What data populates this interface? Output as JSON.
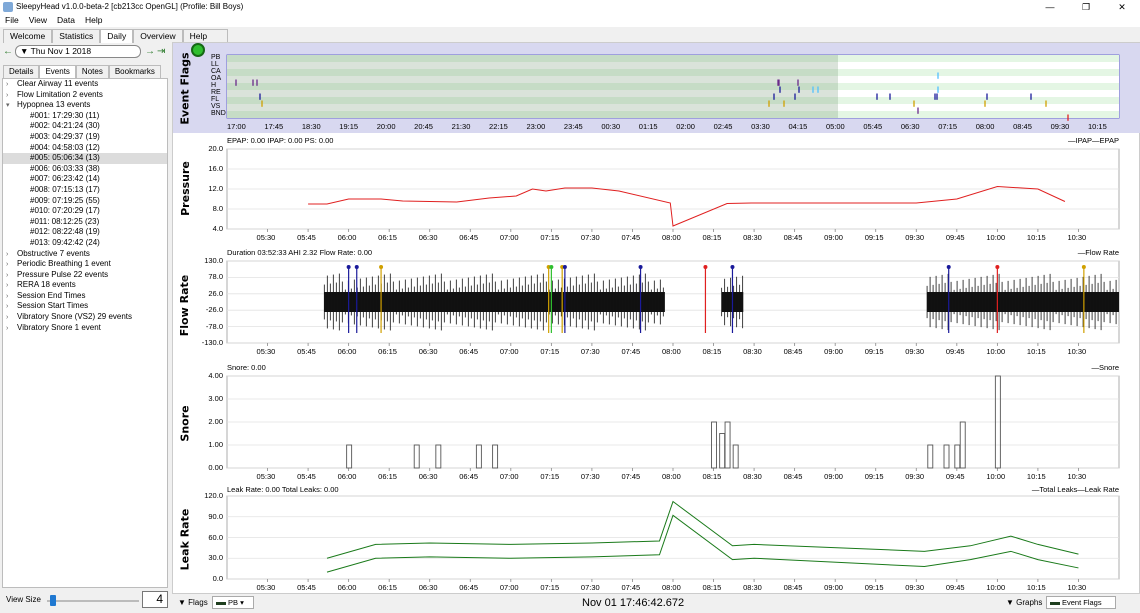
{
  "window": {
    "title": "SleepyHead v1.0.0-beta-2 [cb213cc OpenGL] (Profile: Bill Boys)",
    "min": "—",
    "max": "❐",
    "close": "✕"
  },
  "menu": [
    "File",
    "View",
    "Data",
    "Help"
  ],
  "main_tabs": [
    "Welcome",
    "Statistics",
    "Daily",
    "Overview",
    "Help Browser"
  ],
  "active_main_tab": "Daily",
  "date": {
    "value": "Thu Nov 1 2018",
    "prev": "←",
    "next": "→",
    "jump": "⇥"
  },
  "sub_tabs": [
    "Details",
    "Events",
    "Notes",
    "Bookmarks"
  ],
  "active_sub_tab": "Events",
  "events_tree": [
    {
      "label": "Clear Airway 11 events",
      "expanded": false
    },
    {
      "label": "Flow Limitation 2 events",
      "expanded": false
    },
    {
      "label": "Hypopnea 13 events",
      "expanded": true,
      "children": [
        "#001: 17:29:30 (11)",
        "#002: 04:21:24 (30)",
        "#003: 04:29:37 (19)",
        "#004: 04:58:03 (12)",
        "#005: 05:06:34 (13)",
        "#006: 06:03:33 (38)",
        "#007: 06:23:42 (14)",
        "#008: 07:15:13 (17)",
        "#009: 07:19:25 (55)",
        "#010: 07:20:29 (17)",
        "#011: 08:12:25 (23)",
        "#012: 08:22:48 (19)",
        "#013: 09:42:42 (24)"
      ]
    },
    {
      "label": "Obstructive 7 events",
      "expanded": false
    },
    {
      "label": "Periodic Breathing 1 event",
      "expanded": false
    },
    {
      "label": "Pressure Pulse 22 events",
      "expanded": false
    },
    {
      "label": "RERA 18 events",
      "expanded": false
    },
    {
      "label": "Session End Times",
      "expanded": false
    },
    {
      "label": "Session Start Times",
      "expanded": false
    },
    {
      "label": "Vibratory Snore (VS2) 29 events",
      "expanded": false
    },
    {
      "label": "Vibratory Snore 1 event",
      "expanded": false
    }
  ],
  "selected_event": "#005: 05:06:34 (13)",
  "view_size": {
    "label": "View Size",
    "value": "4"
  },
  "event_flags": {
    "title": "Event Flags",
    "rows": [
      "PB",
      "LL",
      "CA",
      "OA",
      "H",
      "RE",
      "FL",
      "VS",
      "BND"
    ],
    "x_ticks": [
      "17:00",
      "17:45",
      "18:30",
      "19:15",
      "20:00",
      "20:45",
      "21:30",
      "22:15",
      "23:00",
      "23:45",
      "00:30",
      "01:15",
      "02:00",
      "02:45",
      "03:30",
      "04:15",
      "05:00",
      "05:45",
      "06:30",
      "07:15",
      "08:00",
      "08:45",
      "09:30",
      "10:15"
    ]
  },
  "time_ticks": [
    "05:30",
    "05:45",
    "06:00",
    "06:15",
    "06:30",
    "06:45",
    "07:00",
    "07:15",
    "07:30",
    "07:45",
    "08:00",
    "08:15",
    "08:30",
    "08:45",
    "09:00",
    "09:15",
    "09:30",
    "09:45",
    "10:00",
    "10:15",
    "10:30"
  ],
  "pressure": {
    "label": "Pressure",
    "info": "EPAP: 0.00 IPAP: 0.00 PS: 0.00",
    "legend": "—IPAP—EPAP",
    "y_ticks": [
      "20.0",
      "16.0",
      "12.0",
      "8.0",
      "4.0"
    ],
    "color": "#e02020"
  },
  "flow_rate": {
    "label": "Flow Rate",
    "info": "Duration 03:52:33 AHI 2.32 Flow Rate: 0.00",
    "legend": "—Flow Rate",
    "y_ticks": [
      "130.0",
      "78.0",
      "26.0",
      "-26.0",
      "-78.0",
      "-130.0"
    ]
  },
  "snore": {
    "label": "Snore",
    "info": "Snore: 0.00",
    "legend": "—Snore",
    "y_ticks": [
      "4.00",
      "3.00",
      "2.00",
      "1.00",
      "0.00"
    ]
  },
  "leak_rate": {
    "label": "Leak Rate",
    "info": "Leak Rate: 0.00 Total Leaks: 0.00",
    "legend": "—Total Leaks—Leak Rate",
    "y_ticks": [
      "120.0",
      "90.0",
      "60.0",
      "30.0",
      "0.0"
    ],
    "color": "#1a7a1a"
  },
  "bottom": {
    "flags_label": "Flags",
    "pb_label": "PB",
    "datetime": "Nov 01 17:46:42.672",
    "graphs_label": "Graphs",
    "event_flags_label": "Event Flags"
  },
  "chart_data": [
    {
      "type": "line",
      "title": "Pressure",
      "ylabel": "Pressure",
      "ylim": [
        4,
        20
      ],
      "x": [
        "05:45",
        "05:52",
        "06:00",
        "06:12",
        "06:20",
        "06:40",
        "06:52",
        "07:02",
        "07:08",
        "07:13",
        "07:20",
        "07:30",
        "07:40",
        "07:59",
        "08:00",
        "08:20",
        "08:29",
        "09:30",
        "09:45",
        "10:00",
        "10:15",
        "10:25"
      ],
      "series": [
        {
          "name": "IPAP",
          "values": [
            9,
            9,
            10,
            10,
            9.6,
            9.4,
            10.2,
            10.6,
            12,
            11.6,
            12.2,
            12.2,
            11.6,
            9.2,
            4.6,
            9.1,
            9.2,
            9.2,
            10,
            12.5,
            12,
            9.5
          ]
        }
      ]
    },
    {
      "type": "line",
      "title": "Snore",
      "ylabel": "Snore",
      "ylim": [
        0,
        4
      ],
      "x": [
        "06:00",
        "06:25",
        "06:33",
        "06:48",
        "06:54",
        "08:15",
        "08:18",
        "08:20",
        "08:23",
        "09:35",
        "09:41",
        "09:45",
        "09:47",
        "10:00"
      ],
      "series": [
        {
          "name": "Snore",
          "values": [
            1,
            1,
            1,
            1,
            1,
            2,
            1.5,
            2,
            1,
            1,
            1,
            1,
            2,
            4
          ]
        }
      ]
    },
    {
      "type": "line",
      "title": "Leak Rate",
      "ylabel": "Leak Rate",
      "ylim": [
        0,
        120
      ],
      "x": [
        "05:52",
        "06:10",
        "06:30",
        "07:00",
        "07:30",
        "07:55",
        "08:00",
        "08:22",
        "08:30",
        "09:33",
        "09:50",
        "10:05",
        "10:15",
        "10:30"
      ],
      "series": [
        {
          "name": "Total Leaks",
          "values": [
            30,
            50,
            52,
            50,
            52,
            55,
            112,
            48,
            50,
            40,
            48,
            62,
            50,
            36
          ]
        },
        {
          "name": "Leak Rate",
          "values": [
            10,
            30,
            32,
            30,
            32,
            35,
            92,
            28,
            30,
            18,
            28,
            40,
            28,
            16
          ]
        }
      ]
    }
  ]
}
